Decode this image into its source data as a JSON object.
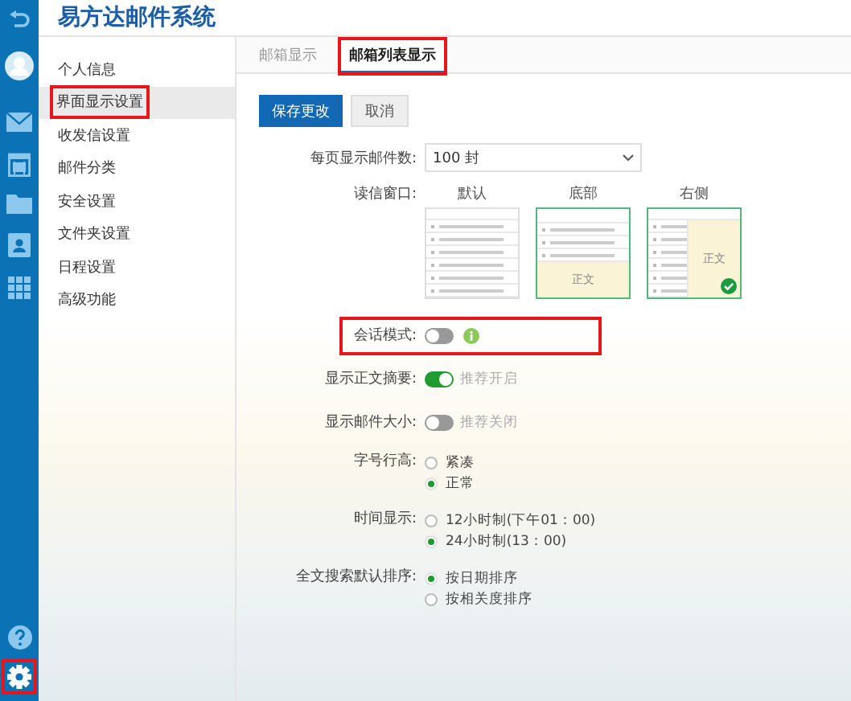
{
  "rail": {
    "settings_highlighted": true
  },
  "title": "易方达邮件系统",
  "menu": [
    {
      "label": "个人信息",
      "selected": false,
      "highlighted": false
    },
    {
      "label": "界面显示设置",
      "selected": true,
      "highlighted": true
    },
    {
      "label": "收发信设置",
      "selected": false,
      "highlighted": false
    },
    {
      "label": "邮件分类",
      "selected": false,
      "highlighted": false
    },
    {
      "label": "安全设置",
      "selected": false,
      "highlighted": false
    },
    {
      "label": "文件夹设置",
      "selected": false,
      "highlighted": false
    },
    {
      "label": "日程设置",
      "selected": false,
      "highlighted": false
    },
    {
      "label": "高级功能",
      "selected": false,
      "highlighted": false
    }
  ],
  "tabs": [
    {
      "label": "邮箱显示",
      "selected": false,
      "highlighted": false
    },
    {
      "label": "邮箱列表显示",
      "selected": true,
      "highlighted": true
    }
  ],
  "buttons": [
    {
      "label": "保存更改",
      "kind": "primary"
    },
    {
      "label": "取消",
      "kind": "secondary"
    }
  ],
  "per_page": {
    "label": "每页显示邮件数:",
    "value": "100 封"
  },
  "reading_pane": {
    "label": "读信窗口:",
    "options": [
      {
        "label": "默认",
        "kind": "none",
        "outlined": false,
        "selected": false
      },
      {
        "label": "底部",
        "kind": "bottom",
        "body": "正文",
        "outlined": true,
        "selected": false
      },
      {
        "label": "右侧",
        "kind": "right",
        "body": "正文",
        "outlined": true,
        "selected": true
      }
    ]
  },
  "toggles": [
    {
      "label": "会话模式:",
      "on": false,
      "info": true,
      "highlighted": true
    },
    {
      "label": "显示正文摘要:",
      "on": true,
      "hint": "推荐开启",
      "highlighted": false
    },
    {
      "label": "显示邮件大小:",
      "on": false,
      "hint": "推荐关闭",
      "highlighted": false
    }
  ],
  "radio_groups": [
    {
      "label": "字号行高:",
      "options": [
        {
          "label": "紧凑",
          "selected": false
        },
        {
          "label": "正常",
          "selected": true
        }
      ]
    },
    {
      "label": "时间显示:",
      "options": [
        {
          "label": "12小时制(下午01：00)",
          "selected": false
        },
        {
          "label": "24小时制(13：00)",
          "selected": true
        }
      ]
    },
    {
      "label": "全文搜索默认排序:",
      "options": [
        {
          "label": "按日期排序",
          "selected": true
        },
        {
          "label": "按相关度排序",
          "selected": false
        }
      ]
    }
  ]
}
